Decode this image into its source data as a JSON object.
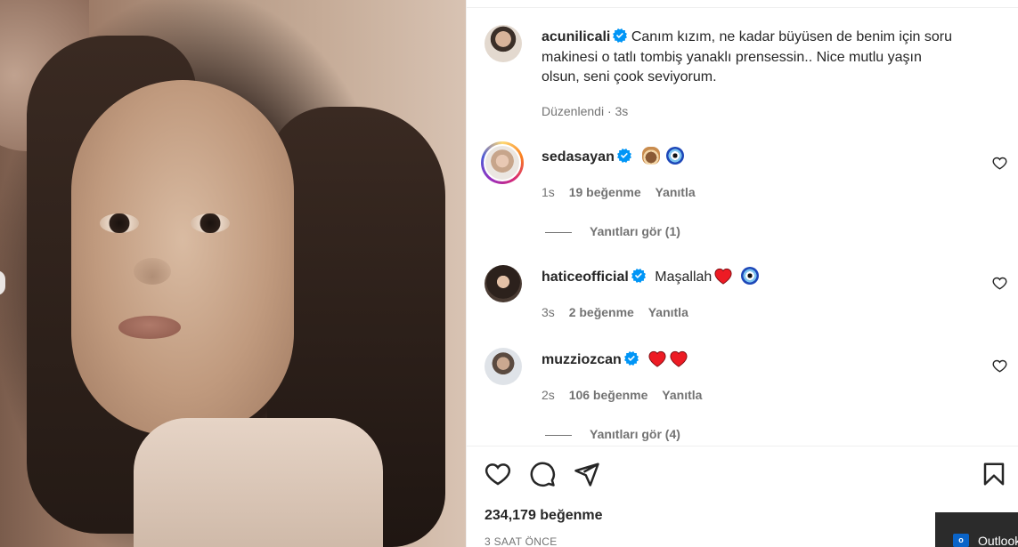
{
  "post": {
    "author": "acunilicali",
    "caption": "Canım kızım, ne kadar büyüsen de benim için soru makinesi o tatlı tombiş yanaklı prensessin.. Nice mutlu yaşın olsun, seni çook seviyorum.",
    "caption_lines": [
      "Canım kızım, ne kadar büyüsen de benim için soru",
      "makinesi o tatlı tombiş yanaklı prensessin.. Nice mutlu yaşın",
      "olsun, seni çook seviyorum."
    ],
    "edited_label": "Düzenlendi · 3s"
  },
  "comments": [
    {
      "username": "sedasayan",
      "text": "",
      "emoji": [
        "cake",
        "nazar"
      ],
      "age": "1s",
      "likes": "19 beğenme",
      "reply_label": "Yanıtla",
      "view_replies": "Yanıtları gör (1)"
    },
    {
      "username": "haticeofficial",
      "text": "Maşallah",
      "emoji": [
        "heart",
        "nazar"
      ],
      "age": "3s",
      "likes": "2 beğenme",
      "reply_label": "Yanıtla",
      "view_replies": ""
    },
    {
      "username": "muzziozcan",
      "text": "",
      "emoji": [
        "heart",
        "heart"
      ],
      "age": "2s",
      "likes": "106 beğenme",
      "reply_label": "Yanıtla",
      "view_replies": "Yanıtları gör (4)"
    }
  ],
  "footer": {
    "likes_count": "234,179 beğenme",
    "posted_time": "3 SAAT ÖNCE"
  },
  "icons": {
    "like": "heart-outline-icon",
    "comment": "comment-bubble-icon",
    "share": "paper-plane-icon",
    "save": "bookmark-icon",
    "verified": "verified-badge-icon"
  },
  "colors": {
    "verified": "#0095f6",
    "heart_red": "#ed1b24",
    "text_primary": "#262626",
    "text_secondary": "#737373"
  },
  "taskbar": {
    "outlook_label": "Outlook"
  }
}
